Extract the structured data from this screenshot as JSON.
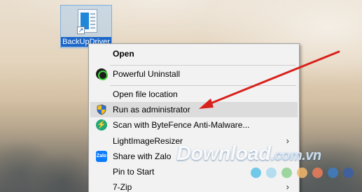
{
  "desktop": {
    "icon_label": "BackUpDriver"
  },
  "context_menu": {
    "items": [
      {
        "label": "Open",
        "bold": true
      },
      {
        "label": "Powerful Uninstall",
        "icon": "uninstall-icon"
      },
      {
        "label": "Open file location"
      },
      {
        "label": "Run as administrator",
        "icon": "uac-shield-icon",
        "highlighted": true
      },
      {
        "label": "Scan with ByteFence Anti-Malware...",
        "icon": "bytefence-icon"
      },
      {
        "label": "LightImageResizer",
        "submenu": true
      },
      {
        "label": "Share with Zalo",
        "icon": "zalo-icon"
      },
      {
        "label": "Pin to Start"
      },
      {
        "label": "7-Zip",
        "submenu": true
      }
    ],
    "zalo_icon_text": "Zalo",
    "bytefence_icon_glyph": "⚡",
    "submenu_glyph": "›"
  },
  "annotation": {
    "arrow_color": "#d8211c"
  },
  "watermark": {
    "text": "Download",
    "suffix": ".com.vn",
    "dot_colors": [
      "#5bc2e7",
      "#a9d9ef",
      "#8fd08f",
      "#f3b96a",
      "#ef7d5a",
      "#3e7cc2",
      "#3a5fa8"
    ]
  }
}
